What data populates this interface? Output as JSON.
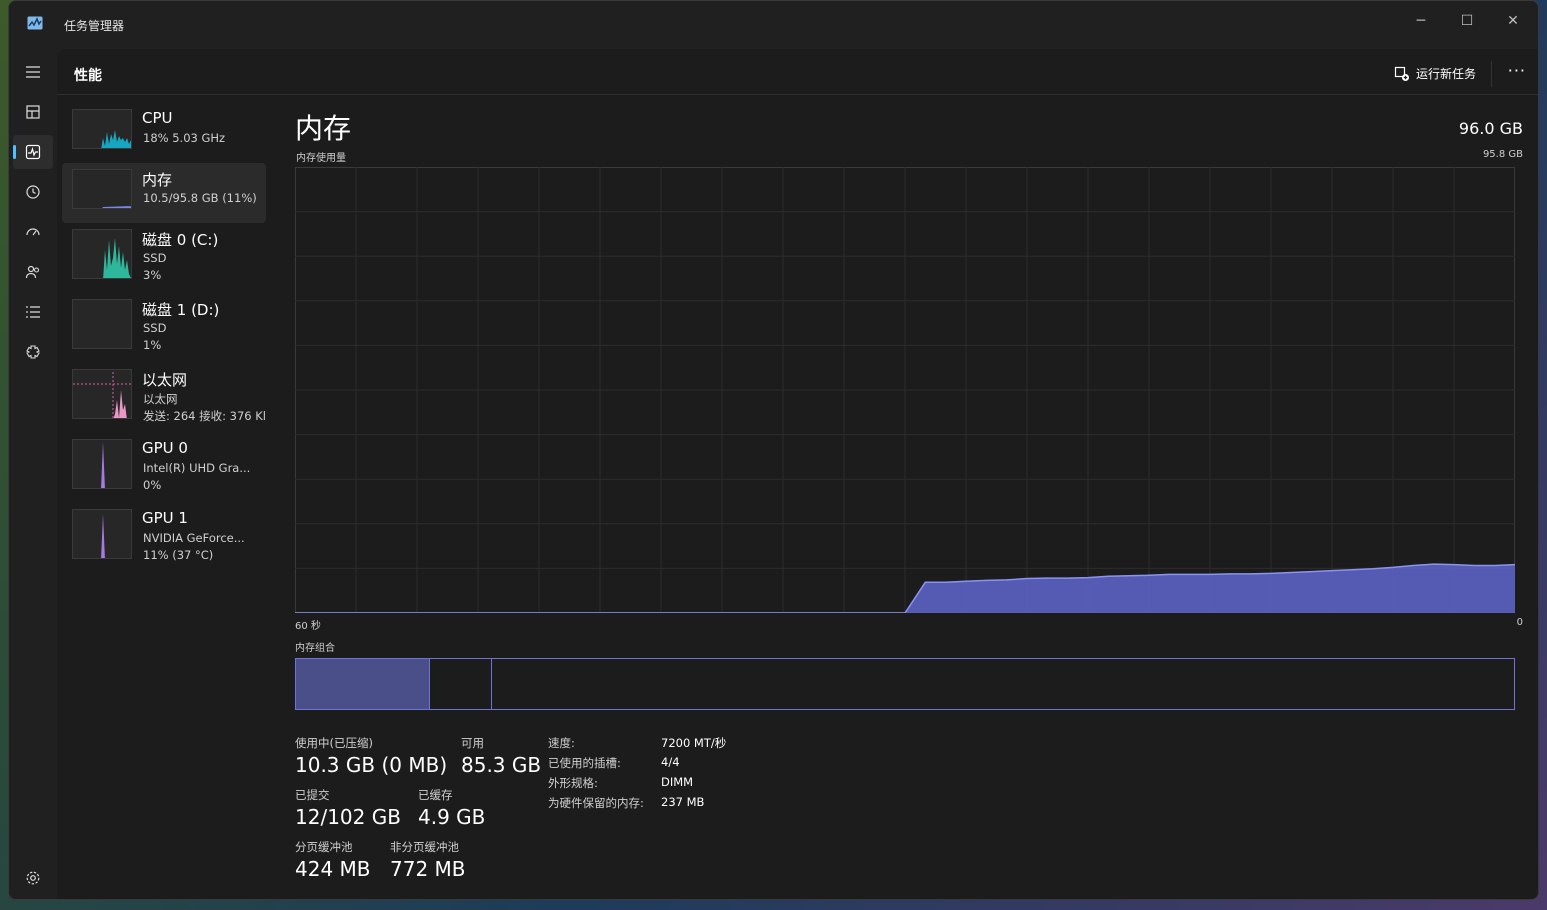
{
  "window": {
    "title": "任务管理器",
    "controls": {
      "minimize": "─",
      "maximize": "☐",
      "close": "✕"
    }
  },
  "header": {
    "page_title": "性能",
    "run_task_label": "运行新任务",
    "more": "···"
  },
  "nav": {
    "items": [
      {
        "icon": "hamburger-icon"
      },
      {
        "icon": "processes-icon"
      },
      {
        "icon": "performance-icon",
        "active": true
      },
      {
        "icon": "app-history-icon"
      },
      {
        "icon": "startup-apps-icon"
      },
      {
        "icon": "users-icon"
      },
      {
        "icon": "details-icon"
      },
      {
        "icon": "services-icon"
      }
    ],
    "settings_icon": "settings-icon"
  },
  "sidebar": {
    "items": [
      {
        "name": "CPU",
        "line1": "18% 5.03 GHz",
        "line2": "",
        "color": "#17a5c1"
      },
      {
        "name": "内存",
        "line1": "10.5/95.8 GB (11%)",
        "line2": "",
        "color": "#7b84e8"
      },
      {
        "name": "磁盘 0 (C:)",
        "line1": "SSD",
        "line2": "3%",
        "color": "#2fb79b"
      },
      {
        "name": "磁盘 1 (D:)",
        "line1": "SSD",
        "line2": "1%",
        "color": "#2fb79b"
      },
      {
        "name": "以太网",
        "line1": "以太网",
        "line2": "发送: 264 接收: 376 Kl",
        "color": "#d85ca6"
      },
      {
        "name": "GPU 0",
        "line1": "Intel(R) UHD Gra...",
        "line2": "0%",
        "color": "#a57be0"
      },
      {
        "name": "GPU 1",
        "line1": "NVIDIA GeForce...",
        "line2": "11% (37 °C)",
        "color": "#a57be0"
      }
    ]
  },
  "main": {
    "title": "内存",
    "total": "96.0 GB",
    "chart_label": "内存使用量",
    "chart_max": "95.8 GB",
    "axis_left": "60 秒",
    "axis_right": "0",
    "composition_label": "内存组合",
    "composition": {
      "in_use": 0.11,
      "modified": 0.0,
      "standby": 0.05
    },
    "stats": {
      "in_use_label": "使用中(已压缩)",
      "in_use_value": "10.3 GB (0 MB)",
      "available_label": "可用",
      "available_value": "85.3 GB",
      "committed_label": "已提交",
      "committed_value": "12/102 GB",
      "cached_label": "已缓存",
      "cached_value": "4.9 GB",
      "paged_label": "分页缓冲池",
      "paged_value": "424 MB",
      "nonpaged_label": "非分页缓冲池",
      "nonpaged_value": "772 MB"
    },
    "specs": {
      "speed_key": "速度:",
      "speed_value": "7200 MT/秒",
      "slots_key": "已使用的插槽:",
      "slots_value": "4/4",
      "form_key": "外形规格:",
      "form_value": "DIMM",
      "reserved_key": "为硬件保留的内存:",
      "reserved_value": "237 MB"
    }
  },
  "chart_data": {
    "type": "area",
    "x": [
      60,
      59,
      58,
      57,
      56,
      55,
      54,
      53,
      52,
      51,
      50,
      49,
      48,
      47,
      46,
      45,
      44,
      43,
      42,
      41,
      40,
      39,
      38,
      37,
      36,
      35,
      34,
      33,
      32,
      31,
      30,
      29,
      28,
      27,
      26,
      25,
      24,
      23,
      22,
      21,
      20,
      19,
      18,
      17,
      16,
      15,
      14,
      13,
      12,
      11,
      10,
      9,
      8,
      7,
      6,
      5,
      4,
      3,
      2,
      1,
      0
    ],
    "series": [
      {
        "values": [
          0,
          0,
          0,
          0,
          0,
          0,
          0,
          0,
          0,
          0,
          0,
          0,
          0,
          0,
          0,
          0,
          0,
          0,
          0,
          0,
          0,
          0,
          0,
          0,
          0,
          0,
          0,
          0,
          0,
          0,
          0,
          6.6,
          6.6,
          6.8,
          7.0,
          7.1,
          7.4,
          7.5,
          7.5,
          7.6,
          7.9,
          8.0,
          8.1,
          8.3,
          8.3,
          8.3,
          8.4,
          8.4,
          8.5,
          8.7,
          8.9,
          9.1,
          9.3,
          9.5,
          9.8,
          10.2,
          10.5,
          10.4,
          10.2,
          10.2,
          10.4
        ],
        "color": "#7b84e8"
      }
    ],
    "ylim": [
      0,
      95.8
    ],
    "xlim": [
      60,
      0
    ],
    "grid": true
  }
}
